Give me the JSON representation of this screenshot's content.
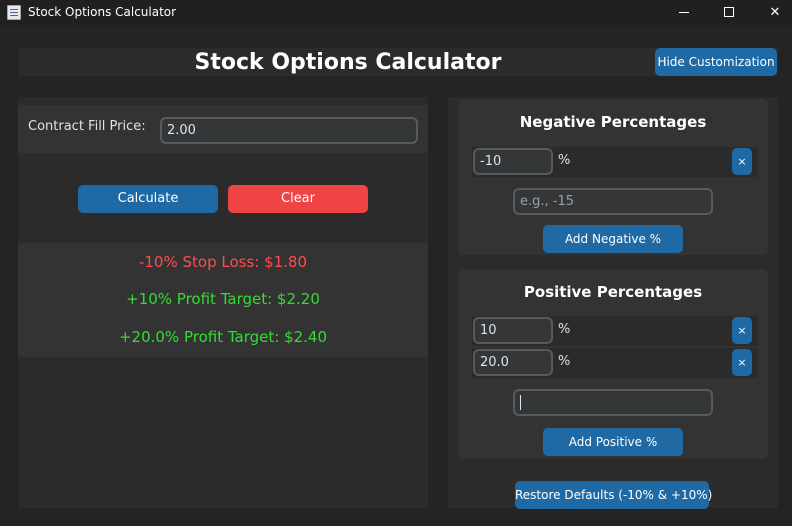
{
  "window": {
    "title": "Stock Options Calculator",
    "minimize_glyph": "",
    "close_glyph": "✕"
  },
  "header": {
    "title": "Stock Options Calculator",
    "hide_button": "Hide Customization"
  },
  "calculator": {
    "fill_label": "Contract Fill Price:",
    "fill_value": "2.00",
    "calculate_button": "Calculate",
    "clear_button": "Clear"
  },
  "results": [
    {
      "text": "-10% Stop Loss: $1.80",
      "color": "#ff4d4d"
    },
    {
      "text": "+10% Profit Target: $2.20",
      "color": "#33dd33"
    },
    {
      "text": "+20.0% Profit Target: $2.40",
      "color": "#33dd33"
    }
  ],
  "negative": {
    "title": "Negative Percentages",
    "items": [
      {
        "value": "-10",
        "unit": "%"
      }
    ],
    "remove_glyph": "×",
    "placeholder": "e.g., -15",
    "add_button": "Add Negative %"
  },
  "positive": {
    "title": "Positive Percentages",
    "items": [
      {
        "value": "10",
        "unit": "%"
      },
      {
        "value": "20.0",
        "unit": "%"
      }
    ],
    "remove_glyph": "×",
    "entry_value": "",
    "add_button": "Add Positive %"
  },
  "restore_button": "Restore Defaults (-10% & +10%)",
  "colors": {
    "accent": "#1f6aa5",
    "danger": "#f04444",
    "loss": "#ff4d4d",
    "profit": "#33dd33"
  }
}
